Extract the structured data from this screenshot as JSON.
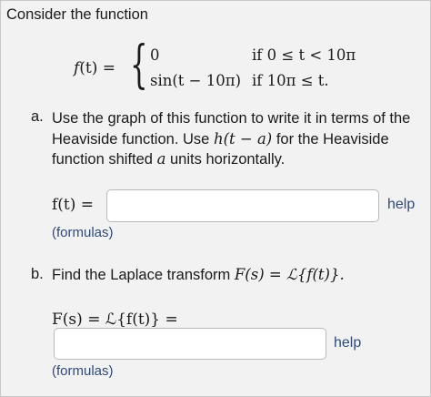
{
  "intro": "Consider the function",
  "piecewise": {
    "lhs_func": "f",
    "lhs_arg": "(t) =",
    "case1_value": "0",
    "case1_condition": "if 0 ≤ t < 10π",
    "case2_value": "sin(t − 10π)",
    "case2_condition": "if 10π ≤ t."
  },
  "part_a": {
    "label": "a.",
    "text_1": "Use the graph of this function to write it in terms of the Heaviside function. Use ",
    "h_expr": "h(t − a)",
    "text_2": " for the Heaviside function shifted ",
    "a_var": "a",
    "text_3": " units horizontally.",
    "answer_label": "f(t) =",
    "answer_value": "",
    "help": "help",
    "formulas": "(formulas)"
  },
  "part_b": {
    "label": "b.",
    "text": "Find the Laplace transform ",
    "expr": "F(s) = ℒ{f(t)}.",
    "answer_label": "F(s) = ℒ{f(t)} =",
    "answer_value": "",
    "help": "help",
    "formulas": "(formulas)"
  }
}
